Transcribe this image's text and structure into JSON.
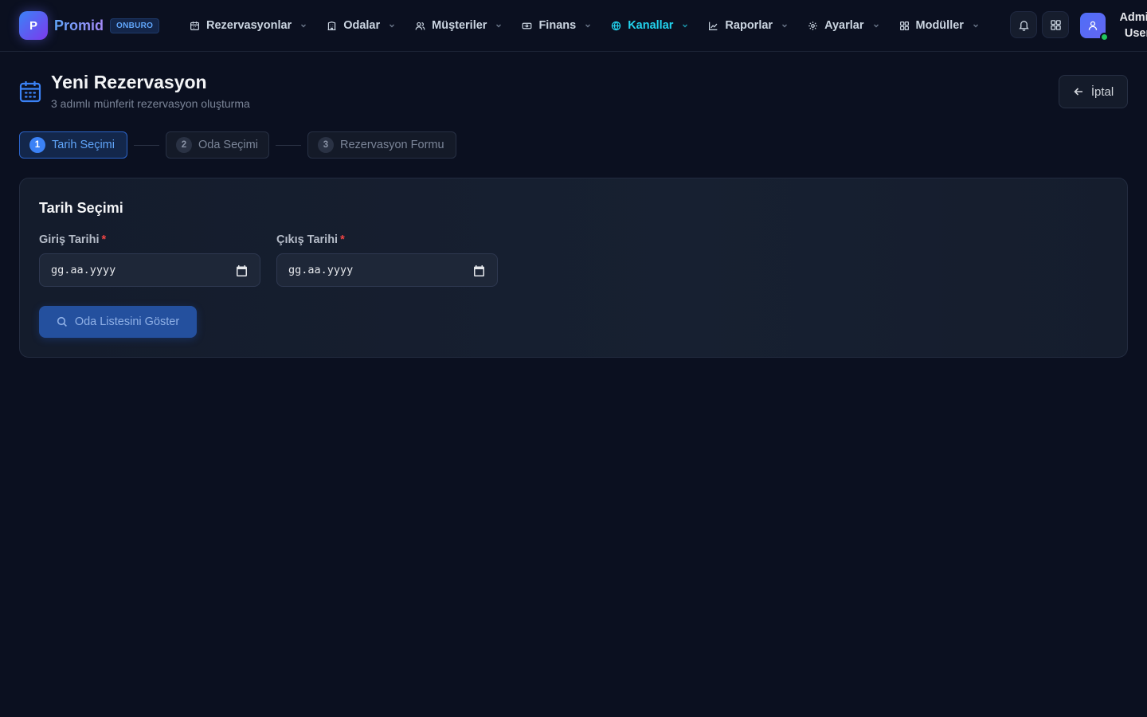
{
  "brand": {
    "logo_letter": "P",
    "name": "Promid",
    "badge": "ONBURO"
  },
  "nav": {
    "items": [
      {
        "label": "Rezervasyonlar",
        "icon": "calendar-icon"
      },
      {
        "label": "Odalar",
        "icon": "building-icon"
      },
      {
        "label": "Müşteriler",
        "icon": "users-icon"
      },
      {
        "label": "Finans",
        "icon": "banknote-icon"
      },
      {
        "label": "Kanallar",
        "icon": "globe-icon",
        "active": true
      },
      {
        "label": "Raporlar",
        "icon": "chart-icon"
      },
      {
        "label": "Ayarlar",
        "icon": "gear-icon"
      },
      {
        "label": "Modüller",
        "icon": "grid-icon"
      }
    ]
  },
  "user": {
    "name": "Admin User",
    "status": "online"
  },
  "header": {
    "title": "Yeni Rezervasyon",
    "subtitle": "3 adımlı münferit rezervasyon oluşturma",
    "cancel_label": "İptal"
  },
  "steps": [
    {
      "number": "1",
      "label": "Tarih Seçimi",
      "active": true
    },
    {
      "number": "2",
      "label": "Oda Seçimi",
      "active": false
    },
    {
      "number": "3",
      "label": "Rezervasyon Formu",
      "active": false
    }
  ],
  "form": {
    "title": "Tarih Seçimi",
    "checkin": {
      "label": "Giriş Tarihi",
      "required_mark": "*",
      "placeholder": "gg.aa.yyyy"
    },
    "checkout": {
      "label": "Çıkış Tarihi",
      "required_mark": "*",
      "placeholder": "gg.aa.yyyy"
    },
    "submit_label": "Oda Listesini Göster"
  },
  "colors": {
    "background": "#0b1020",
    "accent": "#3b82f6",
    "active_nav": "#22d3ee",
    "required": "#ef4444",
    "online": "#22c55e"
  }
}
